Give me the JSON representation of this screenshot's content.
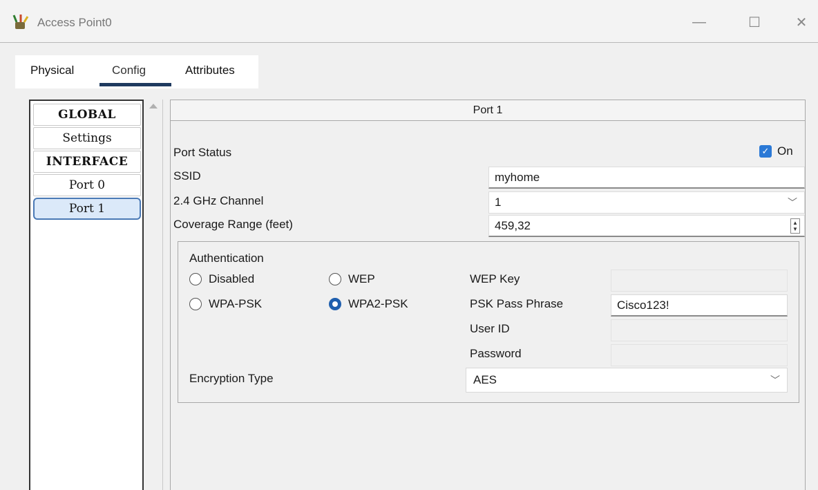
{
  "window": {
    "title": "Access Point0",
    "icon": "access-point-icon",
    "minimize_glyph": "—",
    "maximize_glyph": "☐",
    "close_glyph": "✕"
  },
  "tabs": [
    {
      "label": "Physical"
    },
    {
      "label": "Config",
      "active": true
    },
    {
      "label": "Attributes"
    }
  ],
  "sidebar": {
    "items": [
      {
        "label": "GLOBAL",
        "header": true
      },
      {
        "label": "Settings"
      },
      {
        "label": "INTERFACE",
        "header": true
      },
      {
        "label": "Port 0"
      },
      {
        "label": "Port 1",
        "selected": true
      }
    ]
  },
  "panel": {
    "title": "Port 1",
    "port_status": {
      "label": "Port Status",
      "checkbox_label": "On",
      "checked": true
    },
    "ssid": {
      "label": "SSID",
      "value": "myhome"
    },
    "channel": {
      "label": "2.4 GHz Channel",
      "value": "1"
    },
    "coverage": {
      "label": "Coverage Range (feet)",
      "value": "459,32"
    }
  },
  "authentication": {
    "title": "Authentication",
    "options": {
      "disabled": "Disabled",
      "wep": "WEP",
      "wpa_psk": "WPA-PSK",
      "wpa2_psk": "WPA2-PSK"
    },
    "selected": "WPA2-PSK",
    "wep_key": {
      "label": "WEP Key",
      "value": ""
    },
    "psk_pass_phrase": {
      "label": "PSK Pass Phrase",
      "value": "Cisco123!"
    },
    "user_id": {
      "label": "User ID",
      "value": ""
    },
    "password": {
      "label": "Password",
      "value": ""
    },
    "encryption_type": {
      "label": "Encryption Type",
      "value": "AES"
    }
  },
  "colors": {
    "accent": "#1f5fae",
    "checkbox": "#2b79d6",
    "tab_underline": "#1f3a5f",
    "selected_item_bg": "#dbe9f9"
  }
}
